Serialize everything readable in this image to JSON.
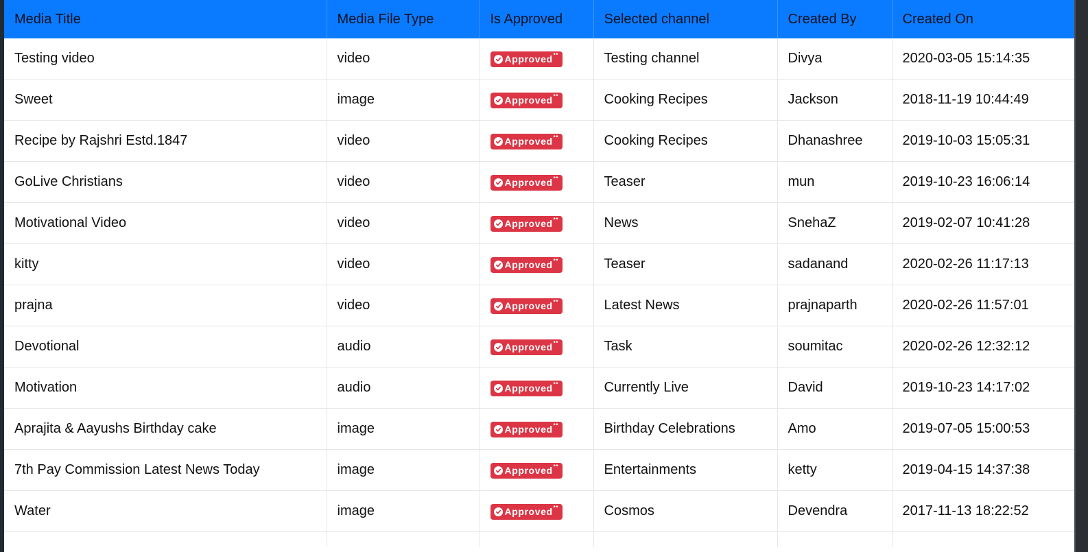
{
  "table": {
    "headers": {
      "media_title": "Media Title",
      "media_file_type": "Media File Type",
      "is_approved": "Is Approved",
      "selected_channel": "Selected channel",
      "created_by": "Created By",
      "created_on": "Created On"
    },
    "badge_marker": "**",
    "rows": [
      {
        "title": "Testing video",
        "type": "video",
        "status": "Approved",
        "channel": "Testing channel",
        "created_by": "Divya",
        "created_on": "2020-03-05 15:14:35"
      },
      {
        "title": "Sweet",
        "type": "image",
        "status": "Approved",
        "channel": "Cooking Recipes",
        "created_by": "Jackson",
        "created_on": "2018-11-19 10:44:49"
      },
      {
        "title": "Recipe by Rajshri Estd.1847",
        "type": "video",
        "status": "Approved",
        "channel": "Cooking Recipes",
        "created_by": "Dhanashree",
        "created_on": "2019-10-03 15:05:31"
      },
      {
        "title": "GoLive Christians",
        "type": "video",
        "status": "Approved",
        "channel": "Teaser",
        "created_by": "mun",
        "created_on": "2019-10-23 16:06:14"
      },
      {
        "title": "Motivational Video",
        "type": "video",
        "status": "Approved",
        "channel": "News",
        "created_by": "SnehaZ",
        "created_on": "2019-02-07 10:41:28"
      },
      {
        "title": "kitty",
        "type": "video",
        "status": "Approved",
        "channel": "Teaser",
        "created_by": "sadanand",
        "created_on": "2020-02-26 11:17:13"
      },
      {
        "title": "prajna",
        "type": "video",
        "status": "Approved",
        "channel": "Latest News",
        "created_by": "prajnaparth",
        "created_on": "2020-02-26 11:57:01"
      },
      {
        "title": "Devotional",
        "type": "audio",
        "status": "Approved",
        "channel": "Task",
        "created_by": "soumitac",
        "created_on": "2020-02-26 12:32:12"
      },
      {
        "title": "Motivation",
        "type": "audio",
        "status": "Approved",
        "channel": "Currently Live",
        "created_by": "David",
        "created_on": "2019-10-23 14:17:02"
      },
      {
        "title": "Aprajita & Aayushs Birthday cake",
        "type": "image",
        "status": "Approved",
        "channel": "Birthday Celebrations",
        "created_by": "Amo",
        "created_on": "2019-07-05 15:00:53"
      },
      {
        "title": "7th Pay Commission Latest News Today",
        "type": "image",
        "status": "Approved",
        "channel": "Entertainments",
        "created_by": "ketty",
        "created_on": "2019-04-15 14:37:38"
      },
      {
        "title": "Water",
        "type": "image",
        "status": "Approved",
        "channel": "Cosmos",
        "created_by": "Devendra",
        "created_on": "2017-11-13 18:22:52"
      }
    ]
  },
  "colors": {
    "header_background": "#0a7bff",
    "badge_background": "#dc3545",
    "page_background": "#ffffff"
  },
  "icons": {
    "badge_icon": "check-circle-icon"
  }
}
